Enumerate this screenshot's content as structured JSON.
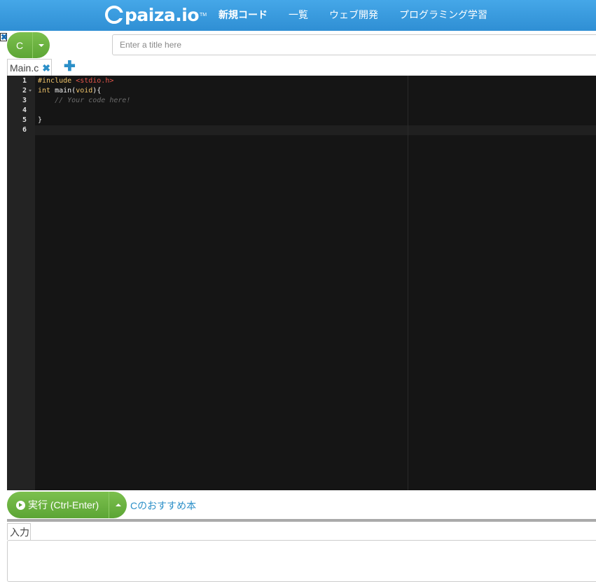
{
  "header": {
    "logo_text": "paiza.io",
    "logo_tm": "TM",
    "nav": [
      {
        "label": "新規コード"
      },
      {
        "label": "一覧"
      },
      {
        "label": "ウェブ開発"
      },
      {
        "label": "プログラミング学習"
      }
    ]
  },
  "toolbar": {
    "close_glyph": "✖",
    "language": "C",
    "title_placeholder": "Enter a title here",
    "title_value": ""
  },
  "tabs": {
    "files": [
      {
        "label": "Main.c"
      }
    ],
    "close_glyph": "✖",
    "add_glyph": "✚"
  },
  "editor": {
    "line_numbers": [
      "1",
      "2",
      "3",
      "4",
      "5",
      "6"
    ],
    "lines": [
      [
        {
          "t": "#include ",
          "c": "kw"
        },
        {
          "t": "<stdio.h>",
          "c": "str"
        }
      ],
      [
        {
          "t": "int ",
          "c": "kw"
        },
        {
          "t": "main(",
          "c": "plain"
        },
        {
          "t": "void",
          "c": "kw"
        },
        {
          "t": "){",
          "c": "plain"
        }
      ],
      [
        {
          "t": "    // Your code here!",
          "c": "cm"
        }
      ],
      [],
      [
        {
          "t": "}",
          "c": "plain"
        }
      ],
      []
    ],
    "active_line": 6
  },
  "run": {
    "label": "実行 (Ctrl-Enter)",
    "book_link": "Cのおすすめ本"
  },
  "input": {
    "tab_label": "入力",
    "value": ""
  },
  "colors": {
    "header_bg": "#3a9ce0",
    "button_green": "#6ab43e",
    "link_blue": "#2b8fc8",
    "editor_bg": "#151515",
    "gutter_bg": "#232323"
  }
}
